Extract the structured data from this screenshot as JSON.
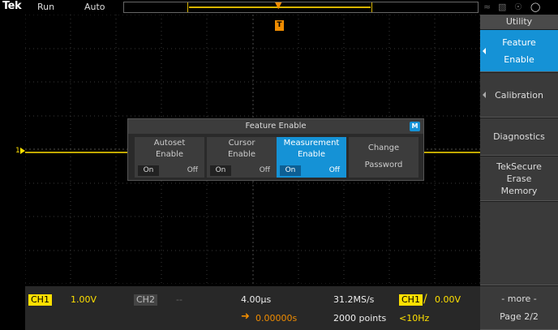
{
  "topbar": {
    "logo": "Tek",
    "run_status": "Run",
    "trigger_mode": "Auto",
    "trigger_position_marker": "T"
  },
  "graticule": {
    "trigger_marker": "T",
    "ch1_ground_marker": "1"
  },
  "side_menu": {
    "title": "Utility",
    "items": [
      {
        "label_line1": "Feature",
        "label_line2": "Enable",
        "active": true
      },
      {
        "label_line1": "Calibration",
        "label_line2": ""
      },
      {
        "label_line1": "Diagnostics",
        "label_line2": ""
      },
      {
        "label_line1": "TekSecure",
        "label_line2": "Erase",
        "label_line3": "Memory"
      },
      {
        "label_line1": "- more -",
        "label_line2": "Page 2/2"
      }
    ]
  },
  "dialog": {
    "title": "Feature Enable",
    "badge": "M",
    "features": [
      {
        "line1": "Autoset",
        "line2": "Enable",
        "on": "On",
        "off": "Off"
      },
      {
        "line1": "Cursor",
        "line2": "Enable",
        "on": "On",
        "off": "Off"
      },
      {
        "line1": "Measurement",
        "line2": "Enable",
        "on": "On",
        "off": "Off"
      },
      {
        "line1": "Change",
        "line2": "Password"
      }
    ]
  },
  "bottom": {
    "ch1_label": "CH1",
    "ch1_scale": "1.00V",
    "ch2_label": "CH2",
    "ch2_scale": "--",
    "time_scale": "4.00µs",
    "sample_rate": "31.2MS/s",
    "record_length": "2000 points",
    "trigger_source": "CH1",
    "trigger_slope": "/",
    "trigger_level": "0.00V",
    "trigger_position": "0.00000s",
    "trigger_frequency": "<10Hz"
  },
  "colors": {
    "ch1": "#ffe000",
    "trigger": "#f08c00",
    "accent": "#1592d6"
  }
}
